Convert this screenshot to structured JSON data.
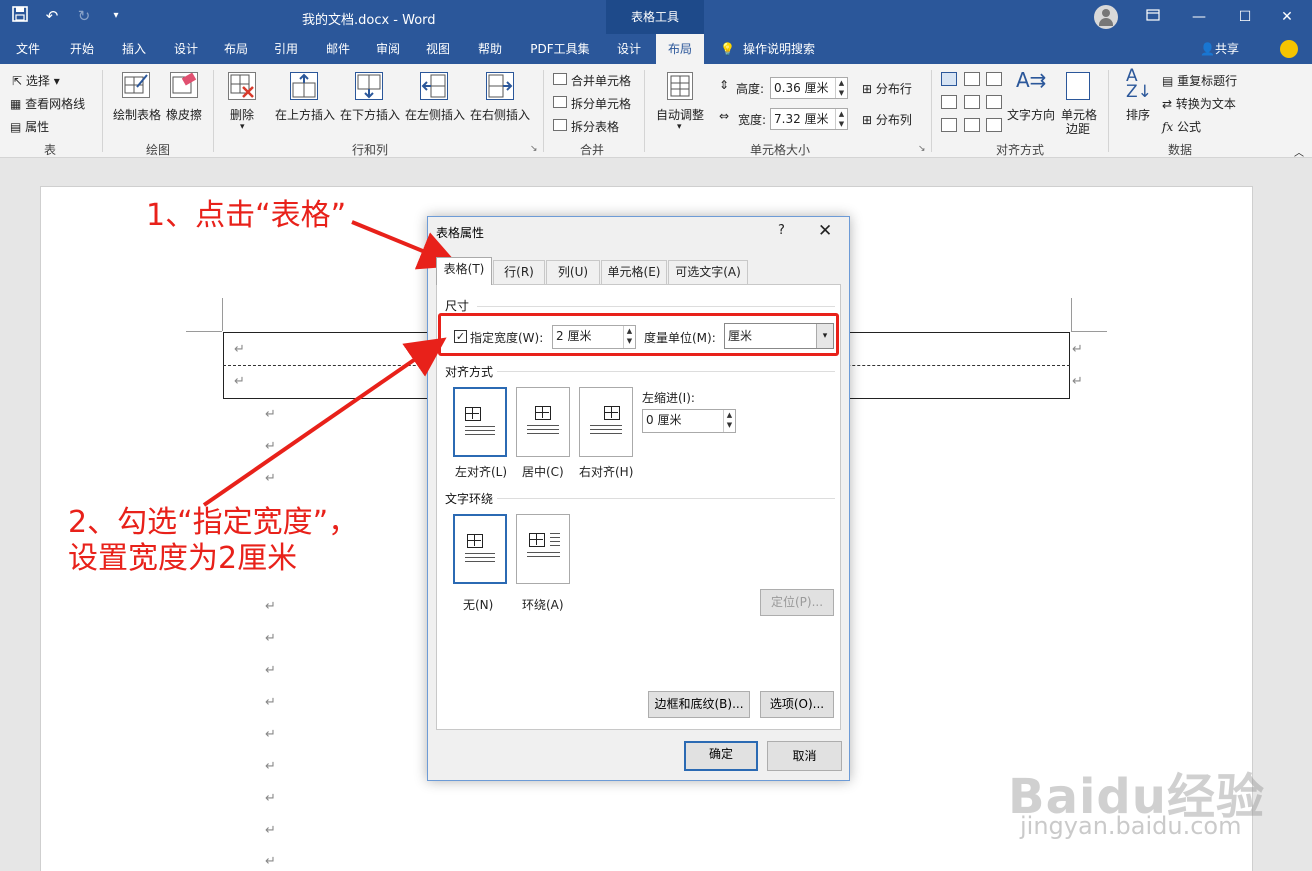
{
  "titlebar": {
    "doc_title": "我的文档.docx  -  Word",
    "tools_label": "表格工具"
  },
  "tabs": [
    "文件",
    "开始",
    "插入",
    "设计",
    "布局",
    "引用",
    "邮件",
    "审阅",
    "视图",
    "帮助",
    "PDF工具集",
    "设计",
    "布局"
  ],
  "search": "操作说明搜索",
  "share": "共享",
  "ribbon": {
    "table_group": {
      "select": "选择",
      "gridlines": "查看网格线",
      "properties": "属性",
      "label": "表"
    },
    "draw_group": {
      "draw_table": "绘制表格",
      "eraser": "橡皮擦",
      "label": "绘图"
    },
    "rows_cols": {
      "delete": "删除",
      "insert_above": "在上方插入",
      "insert_below": "在下方插入",
      "insert_left": "在左侧插入",
      "insert_right": "在右侧插入",
      "label": "行和列"
    },
    "merge": {
      "merge_cells": "合并单元格",
      "split_cells": "拆分单元格",
      "split_table": "拆分表格",
      "label": "合并"
    },
    "cell_size": {
      "autofit": "自动调整",
      "height_label": "高度:",
      "height_value": "0.36 厘米",
      "width_label": "宽度:",
      "width_value": "7.32 厘米",
      "distribute_rows": "分布行",
      "distribute_cols": "分布列",
      "label": "单元格大小"
    },
    "alignment": {
      "text_direction": "文字方向",
      "cell_margins_1": "单元格",
      "cell_margins_2": "边距",
      "label": "对齐方式"
    },
    "data": {
      "sort": "排序",
      "repeat_header": "重复标题行",
      "convert_text": "转换为文本",
      "formula": "公式",
      "label": "数据"
    }
  },
  "annotations": {
    "step1": "1、点击“表格”",
    "step2_line1": "2、勾选“指定宽度”，",
    "step2_line2": "设置宽度为2厘米"
  },
  "dialog": {
    "title": "表格属性",
    "help": "?",
    "close": "✕",
    "tabs": [
      "表格(T)",
      "行(R)",
      "列(U)",
      "单元格(E)",
      "可选文字(A)"
    ],
    "size_section": "尺寸",
    "preferred_width_label": "指定宽度(W):",
    "preferred_width_checked": true,
    "preferred_width_value": "2 厘米",
    "measure_label": "度量单位(M):",
    "measure_value": "厘米",
    "alignment_section": "对齐方式",
    "align_options": [
      "左对齐(L)",
      "居中(C)",
      "右对齐(H)"
    ],
    "indent_label": "左缩进(I):",
    "indent_value": "0 厘米",
    "wrap_section": "文字环绕",
    "wrap_options": [
      "无(N)",
      "环绕(A)"
    ],
    "positioning": "定位(P)...",
    "borders_shading": "边框和底纹(B)...",
    "options": "选项(O)...",
    "ok": "确定",
    "cancel": "取消"
  },
  "paragraph_mark": "↵",
  "watermark": {
    "main": "Baidu经验",
    "sub": "jingyan.baidu.com"
  }
}
